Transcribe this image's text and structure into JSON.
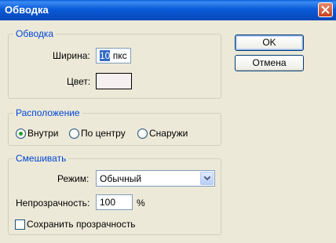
{
  "window": {
    "title": "Обводка"
  },
  "stroke_group": {
    "title": "Обводка",
    "width_label": "Ширина:",
    "width_value": "10",
    "width_unit": "пкс",
    "color_label": "Цвет:",
    "color_value": "#f7f0f0"
  },
  "position_group": {
    "title": "Расположение",
    "options": [
      "Внутри",
      "По центру",
      "Снаружи"
    ],
    "selected": "Внутри"
  },
  "blend_group": {
    "title": "Смешивать",
    "mode_label": "Режим:",
    "mode_value": "Обычный",
    "opacity_label": "Непрозрачность:",
    "opacity_value": "100",
    "opacity_unit": "%",
    "preserve_label": "Сохранить прозрачность",
    "preserve_checked": false
  },
  "buttons": {
    "ok": "OK",
    "cancel": "Отмена"
  },
  "colors": {
    "accent": "#0046d5",
    "titlebar": "#0a5ad8",
    "face": "#ece9d8"
  }
}
